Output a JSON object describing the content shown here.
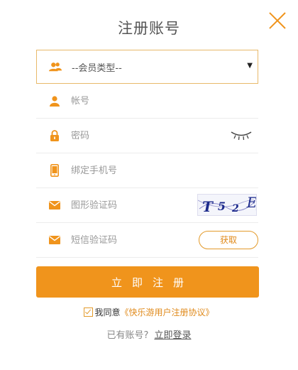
{
  "header": {
    "title": "注册账号"
  },
  "icons": {
    "close": "close-icon",
    "accent": "#f0941c"
  },
  "form": {
    "member_type": "--会员类型--",
    "account_placeholder": "帐号",
    "password_placeholder": "密码",
    "phone_placeholder": "绑定手机号",
    "captcha_placeholder": "图形验证码",
    "captcha_text": "T52E",
    "sms_placeholder": "短信验证码",
    "sms_button": "获取"
  },
  "submit_label": "立即注册",
  "agreement": {
    "prefix": "我同意",
    "link": "《快乐游用户注册协议》"
  },
  "login": {
    "prefix": "已有账号?",
    "link": "立即登录"
  }
}
